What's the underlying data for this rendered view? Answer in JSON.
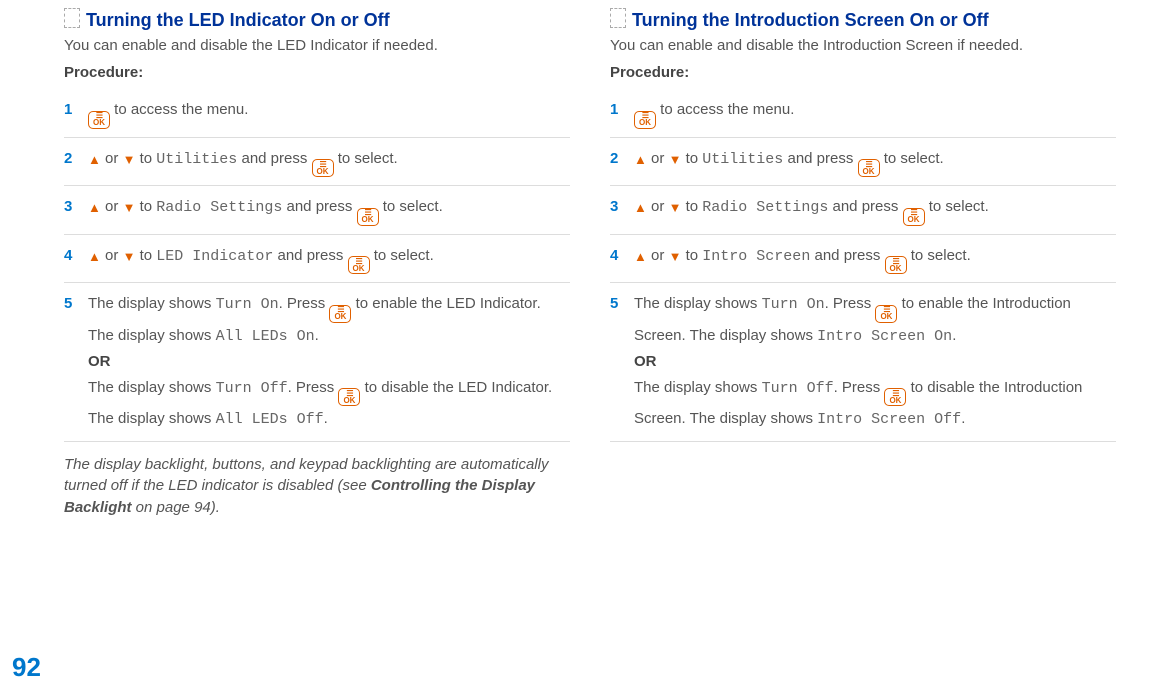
{
  "page_number": "92",
  "ok_glyph_top": "☰",
  "ok_glyph_bottom": "OK",
  "tri_up": "▲",
  "tri_down": "▼",
  "or_word": " or ",
  "to_word": " to ",
  "press_word": " and press ",
  "to_select": " to select.",
  "left": {
    "heading": "Turning the LED Indicator On or Off",
    "intro": "You can enable and disable the LED Indicator if needed.",
    "procedure": "Procedure:",
    "steps": {
      "s1": {
        "num": "1",
        "tail": " to access the menu."
      },
      "s2": {
        "num": "2",
        "target": "Utilities"
      },
      "s3": {
        "num": "3",
        "target": "Radio Settings"
      },
      "s4": {
        "num": "4",
        "target": "LED Indicator"
      },
      "s5": {
        "num": "5",
        "a_pre": "The display shows ",
        "a_mono1": "Turn On",
        "a_mid": ". Press ",
        "a_post1": " to enable the LED Indicator. The display shows ",
        "a_mono2": "All LEDs On",
        "dot": ".",
        "or": "OR",
        "b_pre": "The display shows ",
        "b_mono1": "Turn Off",
        "b_post1": " to disable the LED Indicator. The display shows ",
        "b_mono2": "All LEDs Off"
      }
    },
    "note_a": "The display backlight, buttons, and keypad backlighting are automatically turned off if the LED indicator is disabled (see ",
    "note_bold": "Controlling the Display Backlight",
    "note_b": " on page 94)."
  },
  "right": {
    "heading": "Turning the Introduction Screen On or Off",
    "intro": "You can enable and disable the Introduction Screen if needed.",
    "procedure": "Procedure:",
    "steps": {
      "s1": {
        "num": "1",
        "tail": " to access the menu."
      },
      "s2": {
        "num": "2",
        "target": "Utilities"
      },
      "s3": {
        "num": "3",
        "target": "Radio Settings"
      },
      "s4": {
        "num": "4",
        "target": "Intro Screen"
      },
      "s5": {
        "num": "5",
        "a_pre": "The display shows ",
        "a_mono1": "Turn On",
        "a_mid": ". Press ",
        "a_post1": " to enable the Introduction Screen. The display shows ",
        "a_mono2": "Intro Screen On",
        "dot": ".",
        "or": "OR",
        "b_pre": "The display shows ",
        "b_mono1": "Turn Off",
        "b_post1": " to disable the Introduction Screen. The display shows ",
        "b_mono2": "Intro Screen Off"
      }
    }
  }
}
